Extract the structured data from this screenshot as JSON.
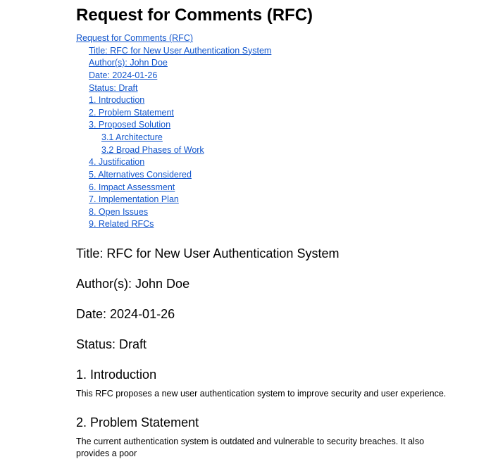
{
  "title": "Request for Comments (RFC)",
  "toc": {
    "root": "Request for Comments (RFC)",
    "level2": [
      "Title: RFC for New User Authentication System",
      "Author(s): John Doe",
      "Date: 2024-01-26",
      "Status: Draft",
      "1. Introduction",
      "2. Problem Statement",
      "3. Proposed Solution"
    ],
    "level3": [
      "3.1 Architecture",
      "3.2 Broad Phases of Work"
    ],
    "level2b": [
      "4. Justification",
      "5. Alternatives Considered",
      "6. Impact Assessment",
      "7. Implementation Plan",
      "8. Open Issues",
      "9. Related RFCs"
    ]
  },
  "sections": {
    "title_h": "Title: RFC for New User Authentication System",
    "author_h": "Author(s): John Doe",
    "date_h": "Date: 2024-01-26",
    "status_h": "Status: Draft",
    "intro_h": "1. Introduction",
    "intro_body": "This RFC proposes a new user authentication system to improve security and user experience.",
    "problem_h": "2. Problem Statement",
    "problem_body": "The current authentication system is outdated and vulnerable to security breaches. It also provides a poor"
  }
}
